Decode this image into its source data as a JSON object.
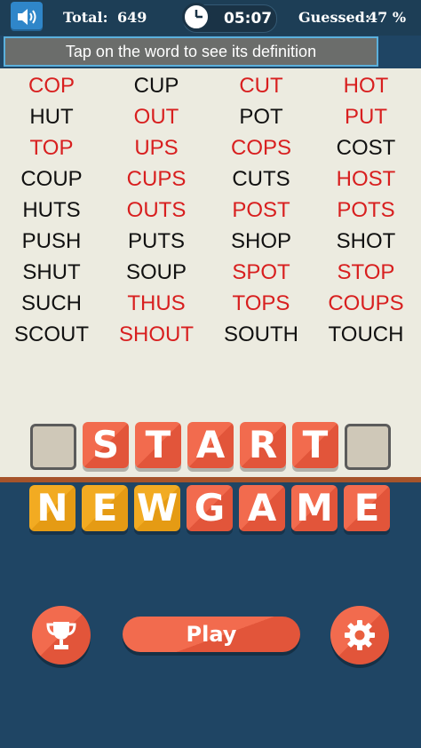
{
  "topbar": {
    "total_label": "Total:",
    "total_value": "649",
    "timer": "05:07",
    "guessed_label": "Guessed:",
    "guessed_value": "47 %"
  },
  "hint": "Tap on the word to see its definition",
  "words": [
    {
      "text": "COP",
      "found": true
    },
    {
      "text": "CUP",
      "found": false
    },
    {
      "text": "CUT",
      "found": true
    },
    {
      "text": "HOT",
      "found": true
    },
    {
      "text": "HUT",
      "found": false
    },
    {
      "text": "OUT",
      "found": true
    },
    {
      "text": "POT",
      "found": false
    },
    {
      "text": "PUT",
      "found": true
    },
    {
      "text": "TOP",
      "found": true
    },
    {
      "text": "UPS",
      "found": true
    },
    {
      "text": "COPS",
      "found": true
    },
    {
      "text": "COST",
      "found": false
    },
    {
      "text": "COUP",
      "found": false
    },
    {
      "text": "CUPS",
      "found": true
    },
    {
      "text": "CUTS",
      "found": false
    },
    {
      "text": "HOST",
      "found": true
    },
    {
      "text": "HUTS",
      "found": false
    },
    {
      "text": "OUTS",
      "found": true
    },
    {
      "text": "POST",
      "found": true
    },
    {
      "text": "POTS",
      "found": true
    },
    {
      "text": "PUSH",
      "found": false
    },
    {
      "text": "PUTS",
      "found": false
    },
    {
      "text": "SHOP",
      "found": false
    },
    {
      "text": "SHOT",
      "found": false
    },
    {
      "text": "SHUT",
      "found": false
    },
    {
      "text": "SOUP",
      "found": false
    },
    {
      "text": "SPOT",
      "found": true
    },
    {
      "text": "STOP",
      "found": true
    },
    {
      "text": "SUCH",
      "found": false
    },
    {
      "text": "THUS",
      "found": true
    },
    {
      "text": "TOPS",
      "found": true
    },
    {
      "text": "COUPS",
      "found": true
    },
    {
      "text": "SCOUT",
      "found": false
    },
    {
      "text": "SHOUT",
      "found": true
    },
    {
      "text": "SOUTH",
      "found": false
    },
    {
      "text": "TOUCH",
      "found": false
    }
  ],
  "start_tiles": [
    "S",
    "T",
    "A",
    "R",
    "T"
  ],
  "newgame_tiles": [
    {
      "letter": "N",
      "color": "yellow"
    },
    {
      "letter": "E",
      "color": "yellow"
    },
    {
      "letter": "W",
      "color": "yellow"
    },
    {
      "letter": "G",
      "color": "red"
    },
    {
      "letter": "A",
      "color": "red"
    },
    {
      "letter": "M",
      "color": "red"
    },
    {
      "letter": "E",
      "color": "red"
    }
  ],
  "buttons": {
    "play_label": "Play",
    "trophy_icon": "trophy-icon",
    "settings_icon": "gear-icon",
    "sound_icon": "speaker-icon"
  },
  "colors": {
    "found_word": "#d81f1f",
    "open_word": "#111111",
    "tile_red": "#f26b4e",
    "tile_yellow": "#f2ab22",
    "bottom_bg": "#1f4564"
  }
}
